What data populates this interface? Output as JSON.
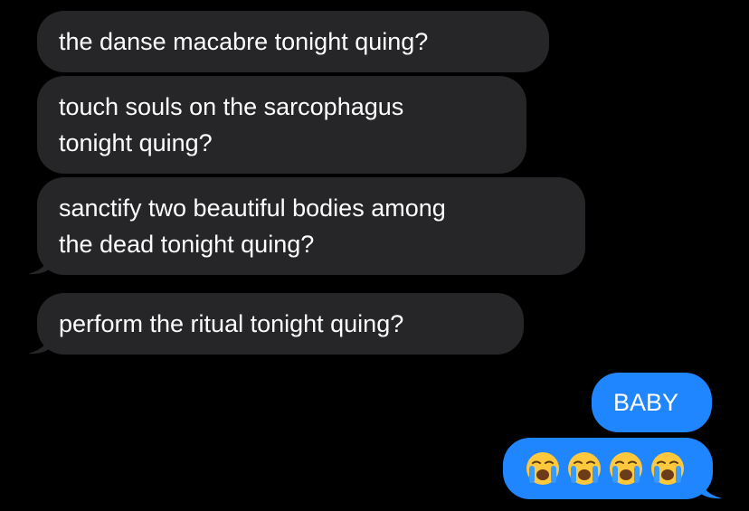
{
  "thread": {
    "incoming": [
      {
        "lines": [
          "the danse macabre tonight quing?"
        ]
      },
      {
        "lines": [
          "touch souls on the sarcophagus",
          "tonight quing?"
        ]
      },
      {
        "lines": [
          "sanctify two beautiful bodies among",
          "the dead tonight quing?"
        ]
      },
      {
        "lines": [
          "perform the ritual tonight quing?"
        ]
      }
    ],
    "outgoing": [
      {
        "text": "BABY"
      },
      {
        "emoji": [
          "loudly-crying-face",
          "loudly-crying-face",
          "loudly-crying-face",
          "loudly-crying-face"
        ]
      }
    ]
  },
  "colors": {
    "background": "#000000",
    "incoming_bubble": "#262628",
    "outgoing_bubble": "#1f86ff",
    "text": "#ffffff"
  }
}
